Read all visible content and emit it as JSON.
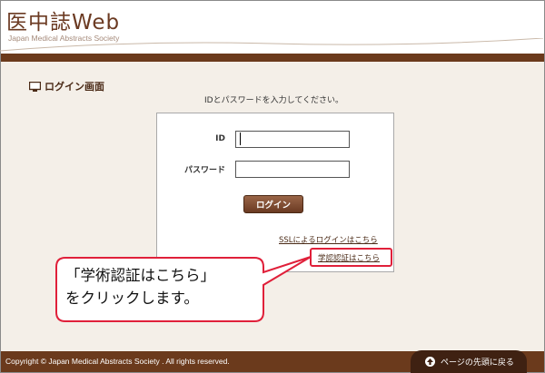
{
  "header": {
    "logo_title": "医中誌Web",
    "logo_subtitle": "Japan Medical Abstracts Society"
  },
  "login_page": {
    "title": "ログイン画面",
    "title_icon": "monitor-icon",
    "instruction": "IDとパスワードを入力してください。",
    "id_label": "ID",
    "id_value": "",
    "password_label": "パスワード",
    "password_value": "",
    "login_button": "ログイン",
    "ssl_link": "SSLによるログインはこちら",
    "academic_auth_link": "学認認証はこちら"
  },
  "callout": {
    "line1": "「学術認証はこちら」",
    "line2": "をクリックします。",
    "border_color": "#e0203a"
  },
  "footer": {
    "copyright": "Copyright © Japan Medical Abstracts Society . All rights reserved.",
    "back_to_top": "ページの先頭に戻る",
    "back_to_top_icon": "arrow-up-icon"
  },
  "colors": {
    "brand_brown": "#6b3a1c",
    "content_bg": "#f4efe8",
    "highlight_red": "#e0203a"
  }
}
